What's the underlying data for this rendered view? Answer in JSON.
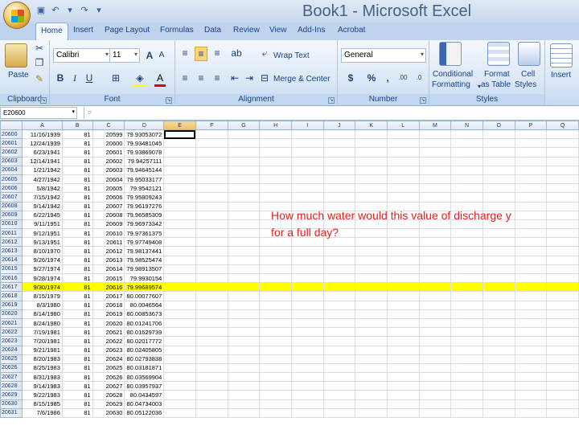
{
  "window": {
    "title": "Book1 - Microsoft Excel"
  },
  "tabs": [
    "Home",
    "Insert",
    "Page Layout",
    "Formulas",
    "Data",
    "Review",
    "View",
    "Add-Ins",
    "Acrobat"
  ],
  "ribbon": {
    "clipboard": {
      "label": "Clipboard",
      "paste": "Paste"
    },
    "font": {
      "label": "Font",
      "name": "Calibri",
      "size": "11"
    },
    "alignment": {
      "label": "Alignment",
      "wrap": "Wrap Text",
      "merge": "Merge & Center"
    },
    "number": {
      "label": "Number",
      "format": "General"
    },
    "styles": {
      "label": "Styles",
      "conditional_1": "Conditional",
      "conditional_2": "Formatting",
      "format_1": "Format",
      "format_2": "as Table",
      "cell_1": "Cell",
      "cell_2": "Styles"
    },
    "cells": {
      "insert": "Insert"
    }
  },
  "namebox": "E20600",
  "columns": [
    "A",
    "B",
    "C",
    "D",
    "E",
    "F",
    "G",
    "H",
    "I",
    "J",
    "K",
    "L",
    "M",
    "N",
    "O",
    "P",
    "Q"
  ],
  "rows": [
    [
      "20600",
      "11/16/1939",
      "81",
      "20599",
      "79.93053072"
    ],
    [
      "20601",
      "12/24/1939",
      "81",
      "20600",
      "79.93481045"
    ],
    [
      "20602",
      "6/23/1941",
      "81",
      "20601",
      "79.93869078"
    ],
    [
      "20603",
      "12/14/1941",
      "81",
      "20602",
      "79.94257111"
    ],
    [
      "20604",
      "1/21/1942",
      "81",
      "20603",
      "79.94645144"
    ],
    [
      "20605",
      "4/27/1942",
      "81",
      "20604",
      "79.95033177"
    ],
    [
      "20606",
      "5/8/1942",
      "81",
      "20605",
      "79.9542121"
    ],
    [
      "20607",
      "7/15/1942",
      "81",
      "20606",
      "79.95809243"
    ],
    [
      "20608",
      "9/14/1942",
      "81",
      "20607",
      "79.96197276"
    ],
    [
      "20609",
      "6/22/1945",
      "81",
      "20608",
      "79.96585309"
    ],
    [
      "20610",
      "9/11/1951",
      "81",
      "20609",
      "79.96973342"
    ],
    [
      "20611",
      "9/12/1951",
      "81",
      "20610",
      "79.97361375"
    ],
    [
      "20612",
      "9/13/1951",
      "81",
      "20611",
      "79.97749408"
    ],
    [
      "20613",
      "8/10/1970",
      "81",
      "20612",
      "79.98137441"
    ],
    [
      "20614",
      "9/26/1974",
      "81",
      "20613",
      "79.98525474"
    ],
    [
      "20615",
      "9/27/1974",
      "81",
      "20614",
      "79.98913507"
    ],
    [
      "20616",
      "9/28/1974",
      "81",
      "20615",
      "79.9930154"
    ],
    [
      "20617",
      "9/30/1974",
      "81",
      "20616",
      "79.99689574"
    ],
    [
      "20618",
      "8/15/1979",
      "81",
      "20617",
      "80.00077607"
    ],
    [
      "20619",
      "8/3/1980",
      "81",
      "20618",
      "80.0046564"
    ],
    [
      "20620",
      "8/14/1980",
      "81",
      "20619",
      "80.00853673"
    ],
    [
      "20621",
      "8/24/1980",
      "81",
      "20620",
      "80.01241706"
    ],
    [
      "20622",
      "7/19/1981",
      "81",
      "20621",
      "80.01629739"
    ],
    [
      "20623",
      "7/20/1981",
      "81",
      "20622",
      "80.02017772"
    ],
    [
      "20624",
      "9/21/1981",
      "81",
      "20623",
      "80.02405805"
    ],
    [
      "20625",
      "8/20/1983",
      "81",
      "20624",
      "80.02793838"
    ],
    [
      "20626",
      "8/25/1983",
      "81",
      "20625",
      "80.03181871"
    ],
    [
      "20627",
      "8/31/1983",
      "81",
      "20626",
      "80.03569904"
    ],
    [
      "20628",
      "9/14/1983",
      "81",
      "20627",
      "80.03957937"
    ],
    [
      "20629",
      "9/22/1983",
      "81",
      "20628",
      "80.0434597"
    ],
    [
      "20630",
      "8/15/1985",
      "81",
      "20629",
      "80.04734003"
    ],
    [
      "20631",
      "7/6/1986",
      "81",
      "20630",
      "80.05122036"
    ]
  ],
  "highlight_row": "20617",
  "question": {
    "line1": "How much water would this value of discharge y",
    "line2": "for a full day?"
  },
  "colors": {
    "highlight": "#ffff00",
    "question": "#e8201a",
    "ribbon": "#dce8f6"
  }
}
